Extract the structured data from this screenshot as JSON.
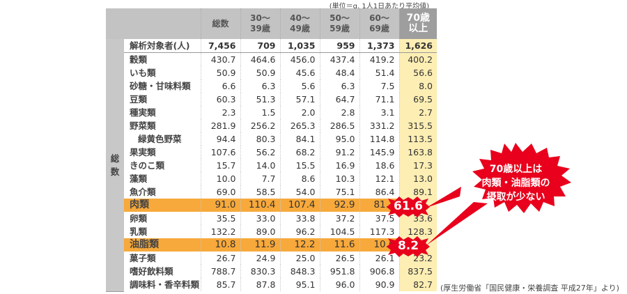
{
  "unit_note": "(単位＝g, 1人1日あたり平均値)",
  "side_label": "総数",
  "columns": [
    "総数",
    "30～\n39歳",
    "40～\n49歳",
    "50～\n59歳",
    "60～\n69歳",
    "70歳\n以上"
  ],
  "header_row": {
    "label": "解析対象者(人)",
    "values": [
      "7,456",
      "709",
      "1,035",
      "959",
      "1,373",
      "1,626"
    ]
  },
  "rows": [
    {
      "label": "穀類",
      "values": [
        "430.7",
        "464.6",
        "456.0",
        "437.4",
        "419.2",
        "400.2"
      ]
    },
    {
      "label": "いも類",
      "values": [
        "50.9",
        "50.9",
        "45.6",
        "48.4",
        "51.4",
        "56.6"
      ]
    },
    {
      "label": "砂糖・甘味料類",
      "values": [
        "6.6",
        "6.3",
        "5.6",
        "6.3",
        "7.5",
        "8.0"
      ]
    },
    {
      "label": "豆類",
      "values": [
        "60.3",
        "51.3",
        "57.1",
        "64.7",
        "71.1",
        "69.5"
      ]
    },
    {
      "label": "種実類",
      "values": [
        "2.3",
        "1.5",
        "2.0",
        "2.8",
        "3.1",
        "2.7"
      ]
    },
    {
      "label": "野菜類",
      "values": [
        "281.9",
        "256.2",
        "265.3",
        "286.5",
        "331.2",
        "315.5"
      ]
    },
    {
      "label": "緑黄色野菜",
      "values": [
        "94.4",
        "80.3",
        "84.1",
        "95.0",
        "114.8",
        "113.5"
      ],
      "indent": true
    },
    {
      "label": "果実類",
      "values": [
        "107.6",
        "56.2",
        "68.2",
        "91.2",
        "145.9",
        "163.8"
      ]
    },
    {
      "label": "きのこ類",
      "values": [
        "15.7",
        "14.0",
        "15.5",
        "16.9",
        "18.6",
        "17.3"
      ]
    },
    {
      "label": "藻類",
      "values": [
        "10.0",
        "7.7",
        "8.6",
        "10.3",
        "12.1",
        "13.0"
      ]
    },
    {
      "label": "魚介類",
      "values": [
        "69.0",
        "58.5",
        "54.0",
        "75.1",
        "86.4",
        "89.1"
      ]
    },
    {
      "label": "肉類",
      "values": [
        "91.0",
        "110.4",
        "107.4",
        "92.9",
        "81.7",
        "61.6"
      ],
      "highlight": true
    },
    {
      "label": "卵類",
      "values": [
        "35.5",
        "33.0",
        "33.8",
        "37.2",
        "37.5",
        "33.6"
      ]
    },
    {
      "label": "乳類",
      "values": [
        "132.2",
        "89.0",
        "96.2",
        "104.5",
        "117.3",
        "128.3"
      ]
    },
    {
      "label": "油脂類",
      "values": [
        "10.8",
        "11.9",
        "12.2",
        "11.6",
        "10.6",
        "8.2"
      ],
      "highlight": true
    },
    {
      "label": "菓子類",
      "values": [
        "26.7",
        "24.9",
        "25.0",
        "26.5",
        "26.1",
        "23.2"
      ]
    },
    {
      "label": "嗜好飲料類",
      "values": [
        "788.7",
        "830.3",
        "848.3",
        "951.8",
        "906.8",
        "837.5"
      ]
    },
    {
      "label": "調味料・香辛料類",
      "values": [
        "85.7",
        "87.8",
        "95.1",
        "96.0",
        "90.9",
        "82.7"
      ]
    }
  ],
  "callout": {
    "line1": "70歳以上は",
    "line2": "肉類・油脂類の",
    "line3": "摂取が少ない"
  },
  "source": "(厚生労働省「国民健康・栄養調査 平成27年」より)",
  "colors": {
    "highlight": "#f7a93b",
    "callout": "#e8001c",
    "elderly_col": "#fdeeb4",
    "header": "#c3c3c3"
  }
}
